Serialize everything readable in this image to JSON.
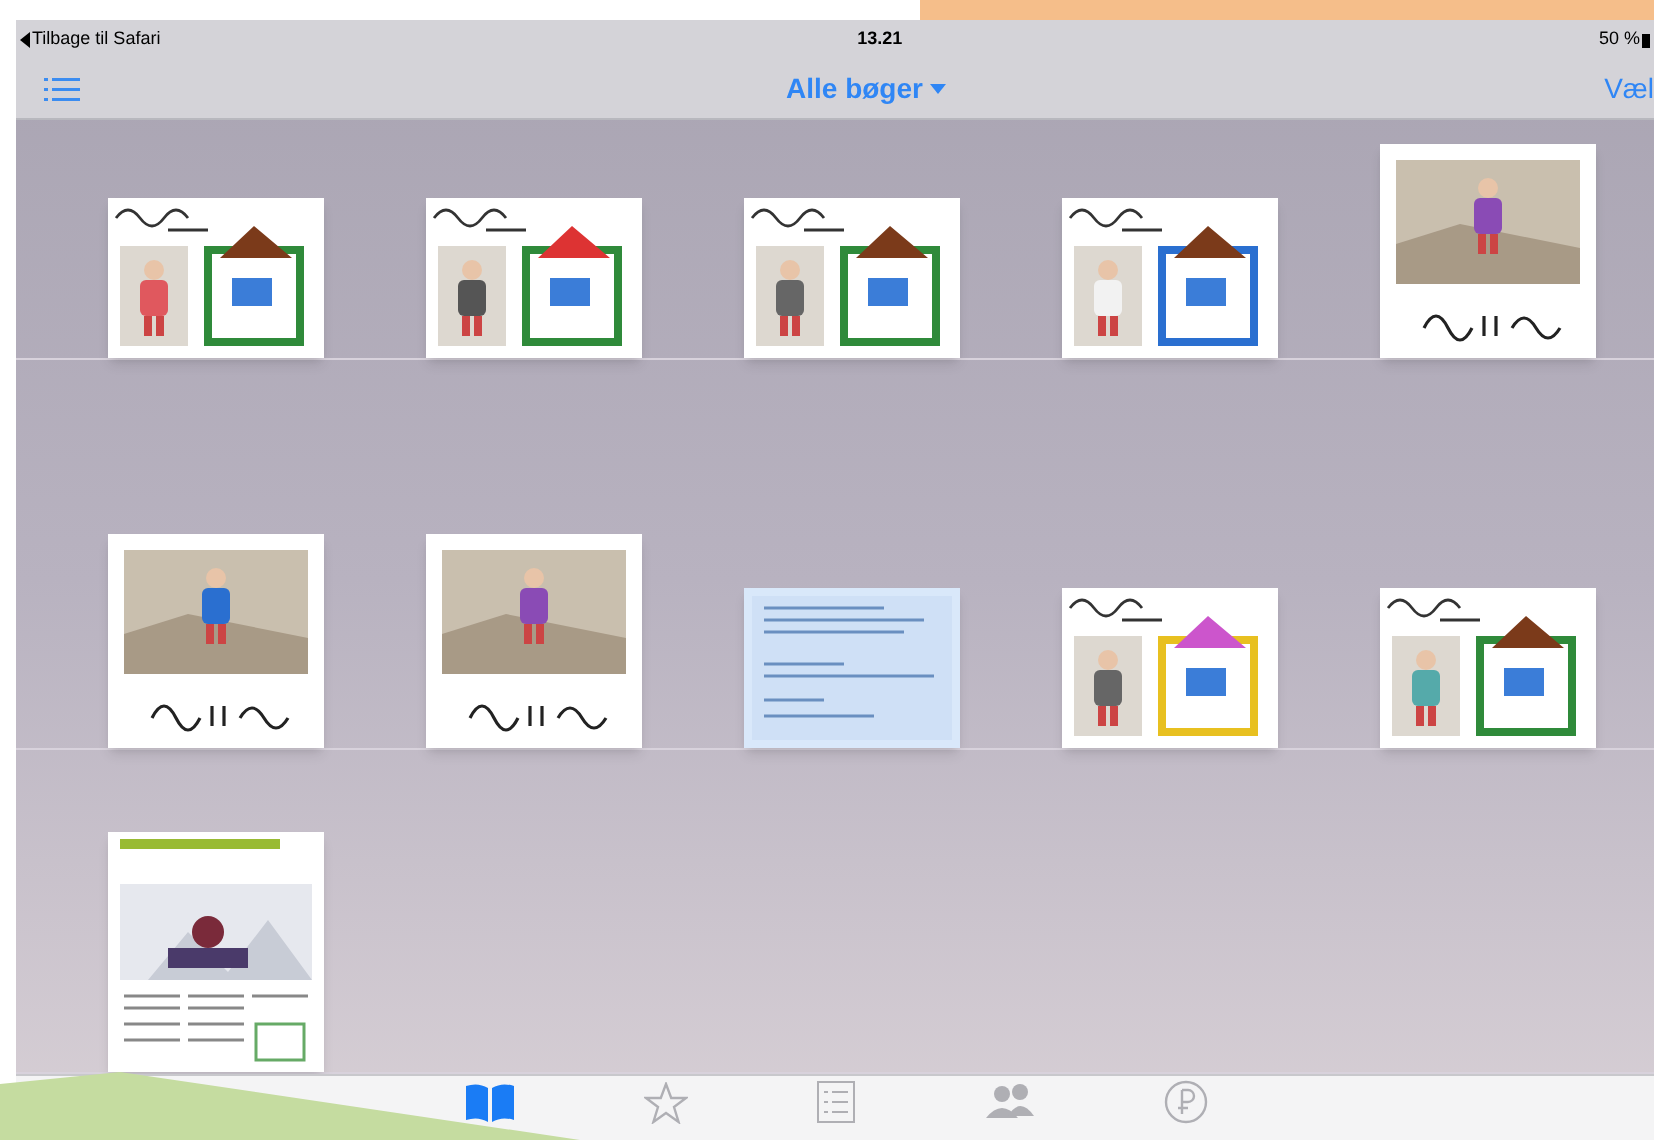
{
  "status_bar": {
    "back_label": "Tilbage til Safari",
    "time": "13.21",
    "battery": "50 %"
  },
  "nav_bar": {
    "title": "Alle bøger",
    "right_button": "Væl"
  },
  "tab_bar": [
    {
      "kind": "books",
      "selected": true
    },
    {
      "kind": "star",
      "selected": false
    },
    {
      "kind": "list",
      "selected": false
    },
    {
      "kind": "people",
      "selected": false
    },
    {
      "kind": "coin",
      "selected": false
    }
  ]
}
